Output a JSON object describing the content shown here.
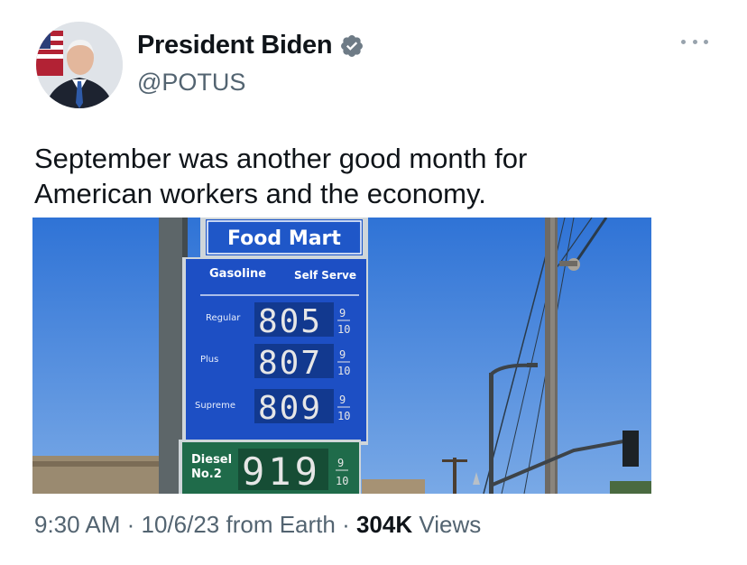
{
  "author": {
    "display_name": "President Biden",
    "handle": "@POTUS",
    "verified_icon": "verified-badge-icon",
    "avatar_icon": "profile-photo"
  },
  "tweet": {
    "text": "September was another good month for\nAmerican workers and the economy."
  },
  "media": {
    "sign": {
      "station_name": "Food Mart",
      "header_left": "Gasoline",
      "header_right": "Self Serve",
      "rows": [
        {
          "grade": "Regular",
          "price": "805",
          "frac_top": "9",
          "frac_bottom": "10"
        },
        {
          "grade": "Plus",
          "price": "807",
          "frac_top": "9",
          "frac_bottom": "10"
        },
        {
          "grade": "Supreme",
          "price": "809",
          "frac_top": "9",
          "frac_bottom": "10"
        }
      ],
      "diesel": {
        "label_line1": "Diesel",
        "label_line2": "No.2",
        "price": "919",
        "frac_top": "9",
        "frac_bottom": "10"
      }
    },
    "colors": {
      "sky": "#3b7fdc",
      "sign_blue": "#1d4fc4",
      "diesel_green": "#1f6b4a",
      "pole": "#505a5e"
    }
  },
  "footer": {
    "time": "9:30 AM",
    "sep1": " · ",
    "date": "10/6/23",
    "source": " from Earth",
    "sep2": " · ",
    "views_count": "304K",
    "views_label": " Views"
  },
  "more_icon": "more-options-icon"
}
